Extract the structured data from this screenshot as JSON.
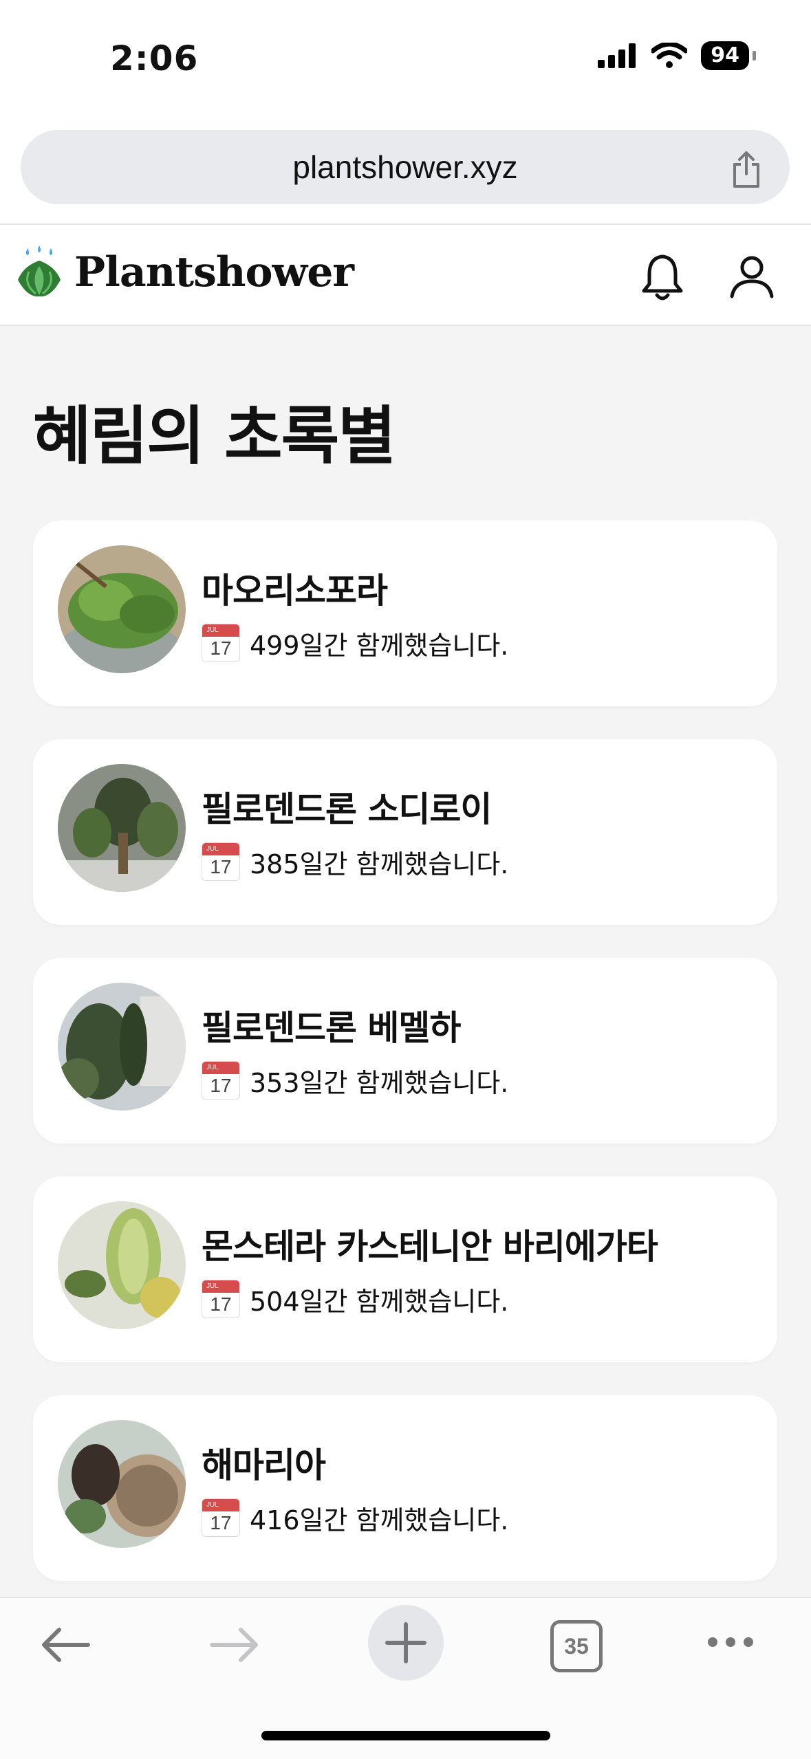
{
  "status_bar": {
    "time": "2:06",
    "battery": "94"
  },
  "browser": {
    "url": "plantshower.xyz",
    "tab_count": "35"
  },
  "site": {
    "brand": "Plantshower"
  },
  "page": {
    "title": "혜림의 초록별"
  },
  "calendar_icon": {
    "month": "JUL",
    "day": "17"
  },
  "plants": [
    {
      "name": "마오리소포라",
      "days": "499일간 함께했습니다."
    },
    {
      "name": "필로덴드론 소디로이",
      "days": "385일간 함께했습니다."
    },
    {
      "name": "필로덴드론 베멜하",
      "days": "353일간 함께했습니다."
    },
    {
      "name": "몬스테라 카스테니안 바리에가타",
      "days": "504일간 함께했습니다."
    },
    {
      "name": "해마리아",
      "days": "416일간 함께했습니다."
    }
  ],
  "colors": {
    "accent_green": "#2e7d32",
    "water_blue": "#42a5f5",
    "background": "#f4f4f5"
  }
}
